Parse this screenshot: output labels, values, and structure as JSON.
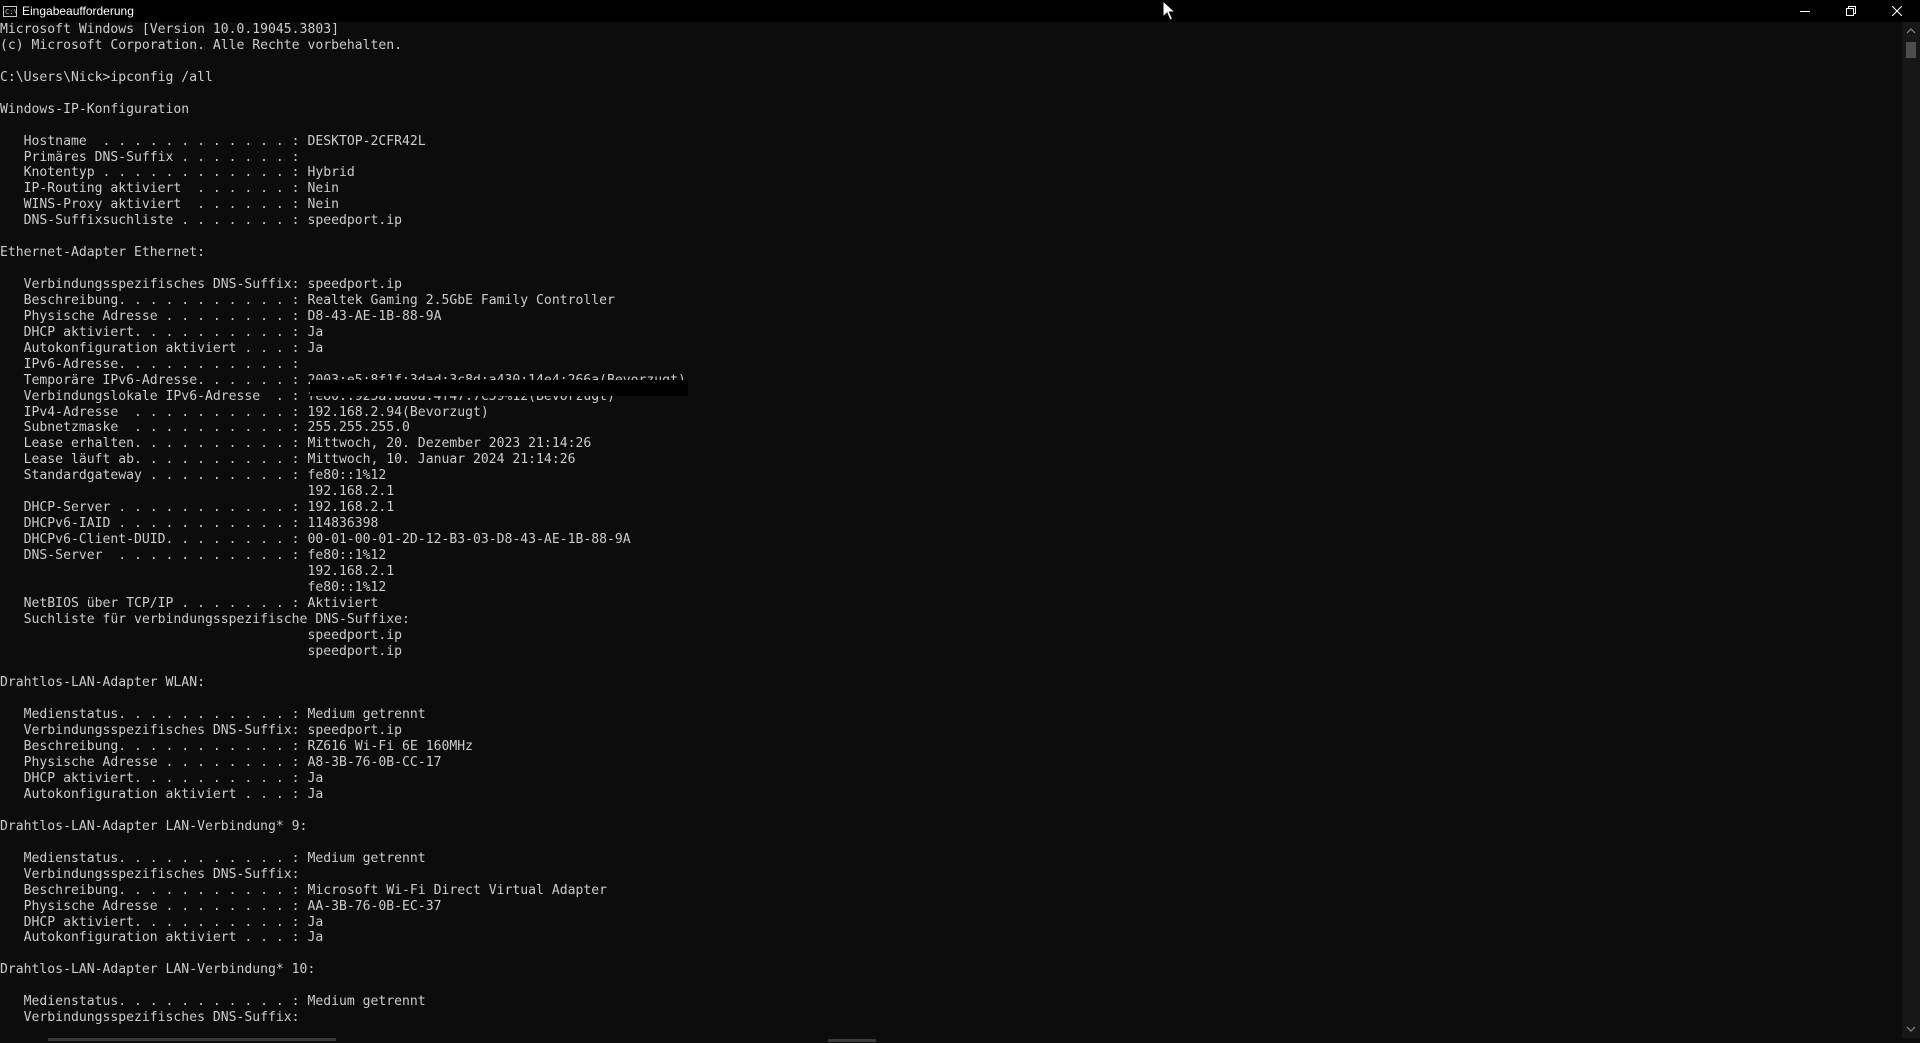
{
  "window": {
    "title": "Eingabeaufforderung",
    "icon": "cmd-icon",
    "controls": [
      "minimize-icon",
      "restore-icon",
      "close-icon"
    ]
  },
  "colors": {
    "background": "#0c0c0c",
    "text": "#cccccc",
    "titlebar": "#000000"
  },
  "terminal": {
    "lines": [
      "Microsoft Windows [Version 10.0.19045.3803]",
      "(c) Microsoft Corporation. Alle Rechte vorbehalten.",
      "",
      "C:\\Users\\Nick>ipconfig /all",
      "",
      "Windows-IP-Konfiguration",
      "",
      "   Hostname  . . . . . . . . . . . . : DESKTOP-2CFR42L",
      "   Primäres DNS-Suffix . . . . . . . :",
      "   Knotentyp . . . . . . . . . . . . : Hybrid",
      "   IP-Routing aktiviert  . . . . . . : Nein",
      "   WINS-Proxy aktiviert  . . . . . . : Nein",
      "   DNS-Suffixsuchliste . . . . . . . : speedport.ip",
      "",
      "Ethernet-Adapter Ethernet:",
      "",
      "   Verbindungsspezifisches DNS-Suffix: speedport.ip",
      "   Beschreibung. . . . . . . . . . . : Realtek Gaming 2.5GbE Family Controller",
      "   Physische Adresse . . . . . . . . : D8-43-AE-1B-88-9A",
      "   DHCP aktiviert. . . . . . . . . . : Ja",
      "   Autokonfiguration aktiviert . . . : Ja",
      "   IPv6-Adresse. . . . . . . . . . . :",
      "   Temporäre IPv6-Adresse. . . . . . : 2003:e5:8f1f:3dad:3c8d:a430:14e4:266a(Bevorzugt)",
      "   Verbindungslokale IPv6-Adresse  . : fe80::925a:ba0a:4f47:7c59%12(Bevorzugt)",
      "   IPv4-Adresse  . . . . . . . . . . : 192.168.2.94(Bevorzugt)",
      "   Subnetzmaske  . . . . . . . . . . : 255.255.255.0",
      "   Lease erhalten. . . . . . . . . . : Mittwoch, 20. Dezember 2023 21:14:26",
      "   Lease läuft ab. . . . . . . . . . : Mittwoch, 10. Januar 2024 21:14:26",
      "   Standardgateway . . . . . . . . . : fe80::1%12",
      "                                       192.168.2.1",
      "   DHCP-Server . . . . . . . . . . . : 192.168.2.1",
      "   DHCPv6-IAID . . . . . . . . . . . : 114836398",
      "   DHCPv6-Client-DUID. . . . . . . . : 00-01-00-01-2D-12-B3-03-D8-43-AE-1B-88-9A",
      "   DNS-Server  . . . . . . . . . . . : fe80::1%12",
      "                                       192.168.2.1",
      "                                       fe80::1%12",
      "   NetBIOS über TCP/IP . . . . . . . : Aktiviert",
      "   Suchliste für verbindungsspezifische DNS-Suffixe:",
      "                                       speedport.ip",
      "                                       speedport.ip",
      "",
      "Drahtlos-LAN-Adapter WLAN:",
      "",
      "   Medienstatus. . . . . . . . . . . : Medium getrennt",
      "   Verbindungsspezifisches DNS-Suffix: speedport.ip",
      "   Beschreibung. . . . . . . . . . . : RZ616 Wi-Fi 6E 160MHz",
      "   Physische Adresse . . . . . . . . : A8-3B-76-0B-CC-17",
      "   DHCP aktiviert. . . . . . . . . . : Ja",
      "   Autokonfiguration aktiviert . . . : Ja",
      "",
      "Drahtlos-LAN-Adapter LAN-Verbindung* 9:",
      "",
      "   Medienstatus. . . . . . . . . . . : Medium getrennt",
      "   Verbindungsspezifisches DNS-Suffix:",
      "   Beschreibung. . . . . . . . . . . : Microsoft Wi-Fi Direct Virtual Adapter",
      "   Physische Adresse . . . . . . . . : AA-3B-76-0B-EC-37",
      "   DHCP aktiviert. . . . . . . . . . : Ja",
      "   Autokonfiguration aktiviert . . . : Ja",
      "",
      "Drahtlos-LAN-Adapter LAN-Verbindung* 10:",
      "",
      "   Medienstatus. . . . . . . . . . . : Medium getrennt",
      "   Verbindungsspezifisches DNS-Suffix:"
    ]
  }
}
